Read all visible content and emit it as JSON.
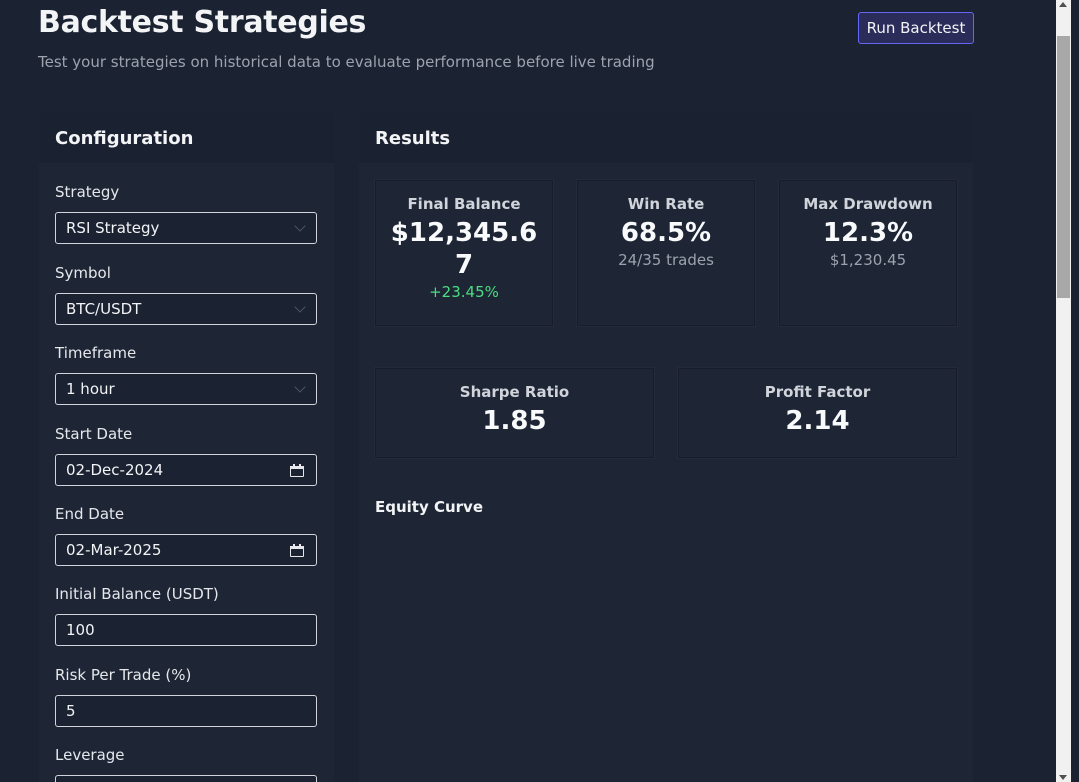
{
  "header": {
    "title": "Backtest Strategies",
    "subtitle": "Test your strategies on historical data to evaluate performance before live trading",
    "run_label": "Run Backtest"
  },
  "config": {
    "title": "Configuration",
    "fields": {
      "strategy": {
        "label": "Strategy",
        "value": "RSI Strategy"
      },
      "symbol": {
        "label": "Symbol",
        "value": "BTC/USDT"
      },
      "timeframe": {
        "label": "Timeframe",
        "value": "1 hour"
      },
      "start_date": {
        "label": "Start Date",
        "value": "02-Dec-2024"
      },
      "end_date": {
        "label": "End Date",
        "value": "02-Mar-2025"
      },
      "initial_balance": {
        "label": "Initial Balance (USDT)",
        "value": "100"
      },
      "risk": {
        "label": "Risk Per Trade (%)",
        "value": "5"
      },
      "leverage": {
        "label": "Leverage",
        "value": ""
      }
    }
  },
  "results": {
    "title": "Results",
    "final_balance": {
      "title": "Final Balance",
      "value_line1": "$12,345.6",
      "value_line2": "7",
      "sub": "+23.45%"
    },
    "win_rate": {
      "title": "Win Rate",
      "value": "68.5%",
      "sub": "24/35 trades"
    },
    "max_drawdown": {
      "title": "Max Drawdown",
      "value": "12.3%",
      "sub": "$1,230.45"
    },
    "sharpe": {
      "title": "Sharpe Ratio",
      "value": "1.85"
    },
    "profit_factor": {
      "title": "Profit Factor",
      "value": "2.14"
    },
    "equity_title": "Equity Curve"
  },
  "colors": {
    "background": "#1b2232",
    "panel": "#1e2636",
    "accent": "#6366f1",
    "positive": "#4ade80"
  }
}
